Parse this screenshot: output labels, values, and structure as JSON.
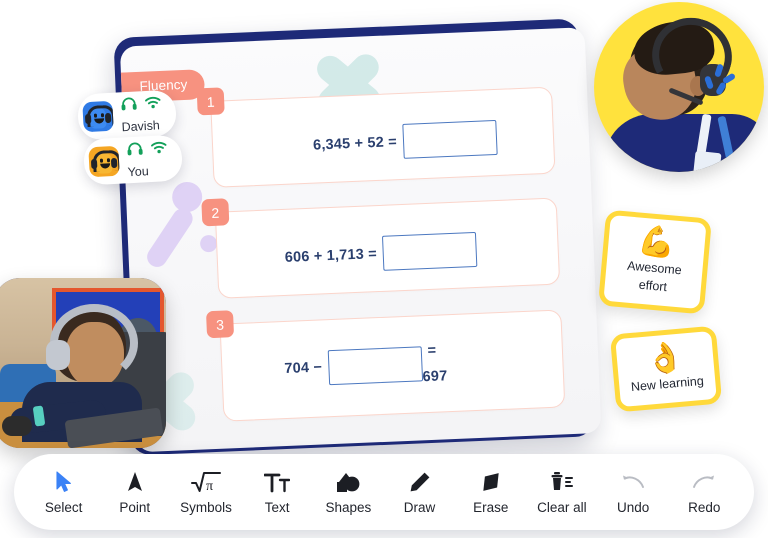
{
  "board": {
    "badge_label": "Fluency",
    "questions": [
      {
        "number": "1",
        "left_expr": "6,345 + 52 =",
        "answer_value": "",
        "right_expr": ""
      },
      {
        "number": "2",
        "left_expr": "606 + 1,713 =",
        "answer_value": "",
        "right_expr": ""
      },
      {
        "number": "3",
        "left_expr": "704 −",
        "answer_value": "",
        "eq_sign": "=",
        "result": "697"
      }
    ]
  },
  "presence": [
    {
      "name": "Davish",
      "avatar_color": "#2f7ae5",
      "headphones_icon": "headphones-icon",
      "wifi_icon": "wifi-icon"
    },
    {
      "name": "You",
      "avatar_color": "#f5a623",
      "headphones_icon": "headphones-icon",
      "wifi_icon": "wifi-icon"
    }
  ],
  "stickers": [
    {
      "emoji": "💪",
      "emoji_name": "flexed-biceps-emoji",
      "label": "Awesome effort"
    },
    {
      "emoji": "👌",
      "emoji_name": "ok-hand-emoji",
      "label": "New learning"
    }
  ],
  "video_tiles": {
    "tutor": {
      "name": "tutor-video-circle",
      "background_color": "#ffe23d"
    },
    "student": {
      "name": "student-video-tile",
      "background_color": "#1f2b7d"
    }
  },
  "toolbar": {
    "items": [
      {
        "label": "Select",
        "icon": "cursor-arrow-icon",
        "active": true,
        "disabled": false
      },
      {
        "label": "Point",
        "icon": "pointer-triangle-icon",
        "active": false,
        "disabled": false
      },
      {
        "label": "Symbols",
        "icon": "square-root-pi-icon",
        "active": false,
        "disabled": false
      },
      {
        "label": "Text",
        "icon": "text-tt-icon",
        "active": false,
        "disabled": false
      },
      {
        "label": "Shapes",
        "icon": "shapes-icon",
        "active": false,
        "disabled": false
      },
      {
        "label": "Draw",
        "icon": "pencil-icon",
        "active": false,
        "disabled": false
      },
      {
        "label": "Erase",
        "icon": "eraser-icon",
        "active": false,
        "disabled": false
      },
      {
        "label": "Clear all",
        "icon": "trash-lines-icon",
        "active": false,
        "disabled": false
      },
      {
        "label": "Undo",
        "icon": "undo-arrow-icon",
        "active": false,
        "disabled": true
      },
      {
        "label": "Redo",
        "icon": "redo-arrow-icon",
        "active": false,
        "disabled": true
      }
    ]
  },
  "colors": {
    "board_frame": "#1e2a78",
    "accent_coral": "#f79280",
    "answer_box_border": "#4c78c0",
    "sticker_border": "#ffd93b",
    "select_active": "#3b82f6",
    "text_navy": "#2a3f6e"
  }
}
